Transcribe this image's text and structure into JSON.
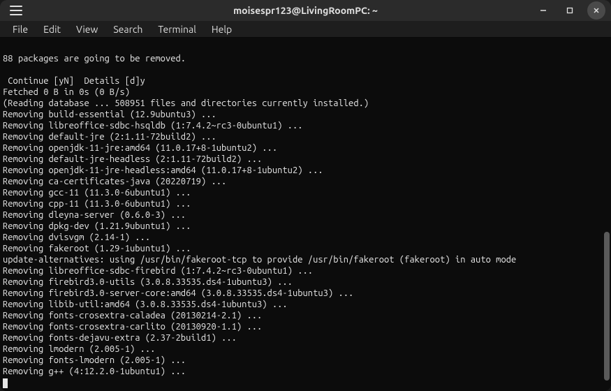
{
  "titlebar": {
    "title": "moisespr123@LivingRoomPC: ~"
  },
  "menubar": {
    "items": [
      {
        "label": "File"
      },
      {
        "label": "Edit"
      },
      {
        "label": "View"
      },
      {
        "label": "Search"
      },
      {
        "label": "Terminal"
      },
      {
        "label": "Help"
      }
    ]
  },
  "terminal": {
    "lines": [
      "",
      "88 packages are going to be removed.",
      "",
      " Continue [yN]  Details [d]y",
      "Fetched 0 B in 0s (0 B/s)",
      "(Reading database ... 508951 files and directories currently installed.)",
      "Removing build-essential (12.9ubuntu3) ...",
      "Removing libreoffice-sdbc-hsqldb (1:7.4.2~rc3-0ubuntu1) ...",
      "Removing default-jre (2:1.11-72build2) ...",
      "Removing openjdk-11-jre:amd64 (11.0.17+8-1ubuntu2) ...",
      "Removing default-jre-headless (2:1.11-72build2) ...",
      "Removing openjdk-11-jre-headless:amd64 (11.0.17+8-1ubuntu2) ...",
      "Removing ca-certificates-java (20220719) ...",
      "Removing gcc-11 (11.3.0-6ubuntu1) ...",
      "Removing cpp-11 (11.3.0-6ubuntu1) ...",
      "Removing dleyna-server (0.6.0-3) ...",
      "Removing dpkg-dev (1.21.9ubuntu1) ...",
      "Removing dvisvgm (2.14-1) ...",
      "Removing fakeroot (1.29-1ubuntu1) ...",
      "update-alternatives: using /usr/bin/fakeroot-tcp to provide /usr/bin/fakeroot (fakeroot) in auto mode",
      "Removing libreoffice-sdbc-firebird (1:7.4.2~rc3-0ubuntu1) ...",
      "Removing firebird3.0-utils (3.0.8.33535.ds4-1ubuntu3) ...",
      "Removing firebird3.0-server-core:amd64 (3.0.8.33535.ds4-1ubuntu3) ...",
      "Removing libib-util:amd64 (3.0.8.33535.ds4-1ubuntu3) ...",
      "Removing fonts-crosextra-caladea (20130214-2.1) ...",
      "Removing fonts-crosextra-carlito (20130920-1.1) ...",
      "Removing fonts-dejavu-extra (2.37-2build1) ...",
      "Removing lmodern (2.005-1) ...",
      "Removing fonts-lmodern (2.005-1) ...",
      "Removing g++ (4:12.2.0-1ubuntu1) ..."
    ]
  },
  "scrollbar": {
    "thumb_top_pct": 55,
    "thumb_height_pct": 42
  }
}
